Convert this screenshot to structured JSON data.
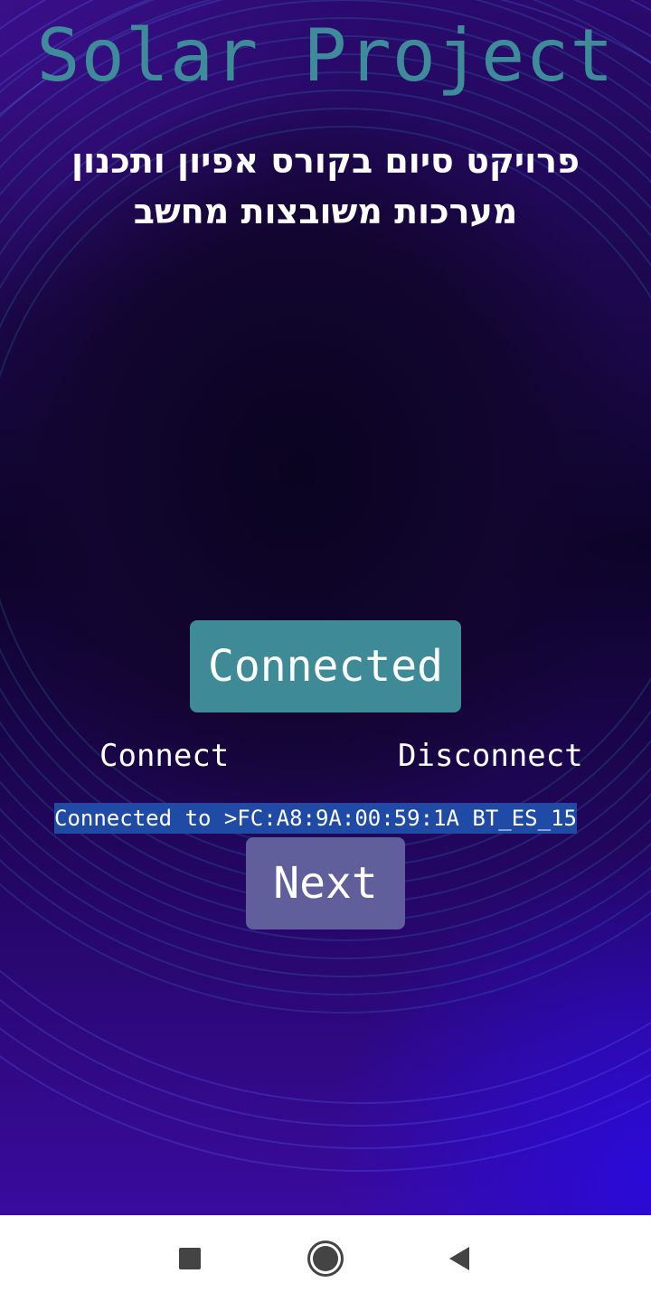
{
  "app": {
    "title": "Solar Project",
    "subtitle": "פרויקט סיום בקורס אפיון ותכנון מערכות משובצות מחשב"
  },
  "buttons": {
    "connected_label": "Connected",
    "connect_label": "Connect",
    "disconnect_label": "Disconnect",
    "next_label": "Next"
  },
  "status": {
    "text": "Connected to >FC:A8:9A:00:59:1A BT_ES_15"
  },
  "colors": {
    "title": "#3e8c9a",
    "connected_button": "#3e8a96",
    "next_button": "#615e9c",
    "status_highlight": "#1f4aa6"
  },
  "navbar": {
    "icons": [
      "recent-apps-icon",
      "home-icon",
      "back-icon"
    ]
  }
}
